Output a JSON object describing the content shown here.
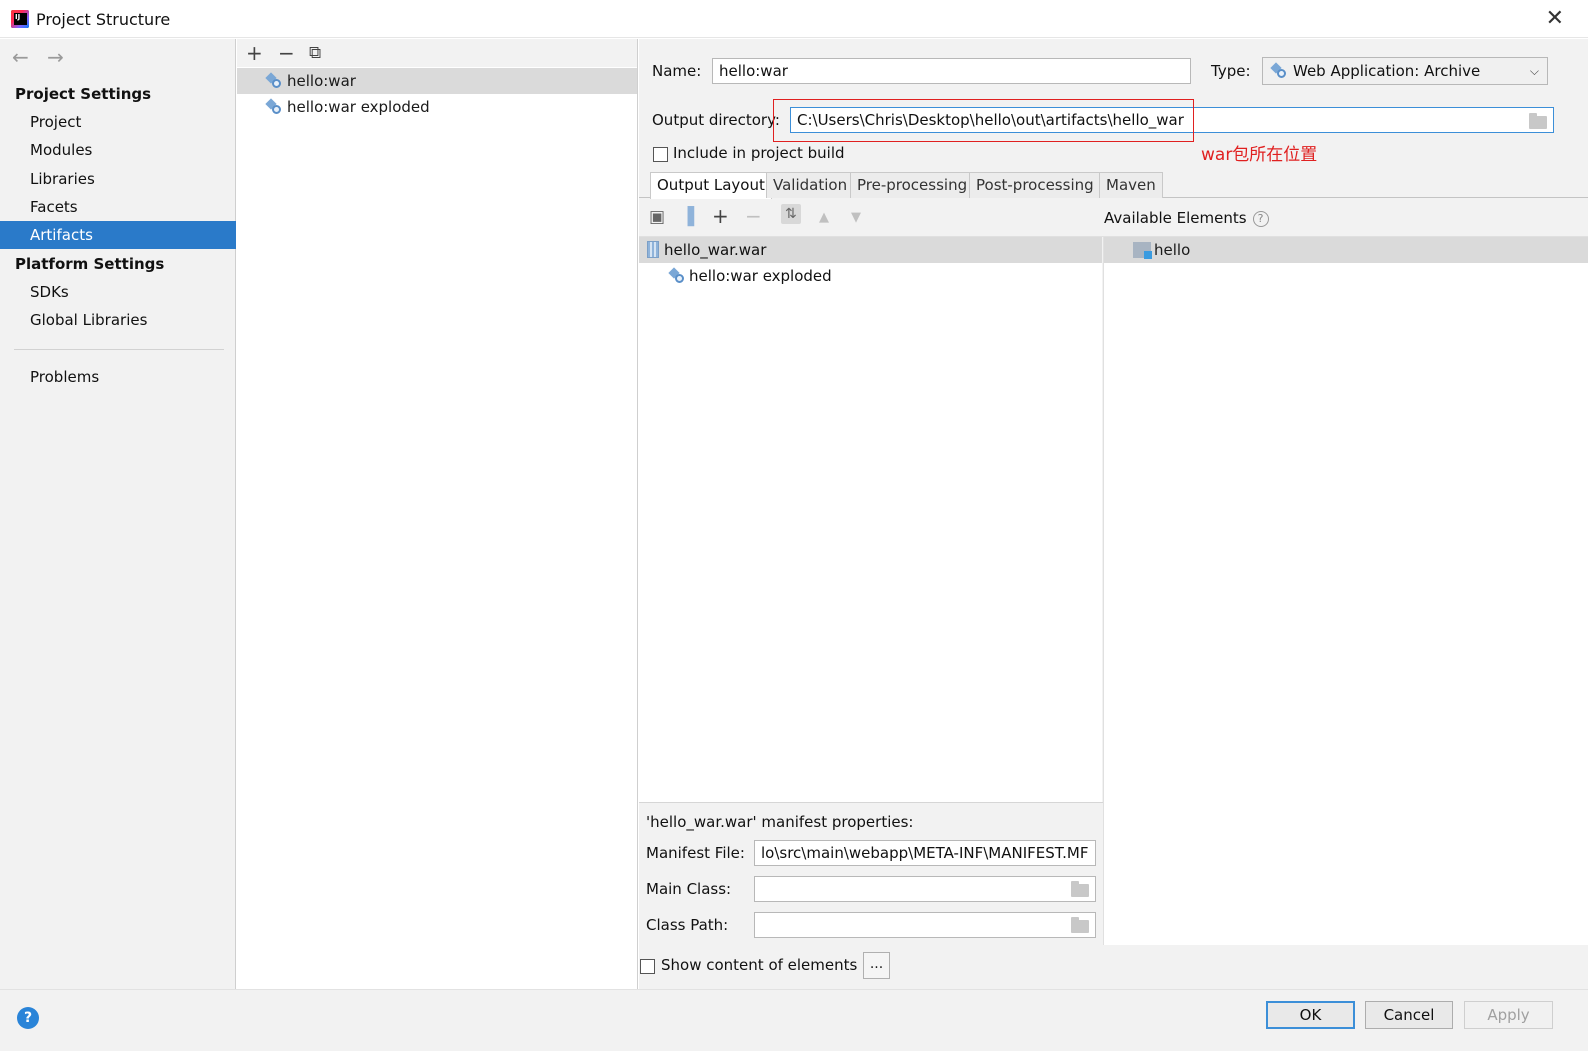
{
  "window": {
    "title": "Project Structure",
    "close_glyph": "✕",
    "icon": "intellij-icon"
  },
  "nav": {
    "back_glyph": "←",
    "forward_glyph": "→",
    "project_settings_heading": "Project Settings",
    "project_items": [
      "Project",
      "Modules",
      "Libraries",
      "Facets",
      "Artifacts"
    ],
    "selected": "Artifacts",
    "platform_settings_heading": "Platform Settings",
    "platform_items": [
      "SDKs",
      "Global Libraries"
    ],
    "problems": "Problems"
  },
  "artifacts_list": {
    "add_glyph": "+",
    "remove_glyph": "−",
    "copy_glyph": "⧉",
    "items": [
      "hello:war",
      "hello:war exploded"
    ],
    "selected": "hello:war"
  },
  "detail": {
    "name_label": "Name:",
    "name_value": "hello:war",
    "type_label": "Type:",
    "type_value": "Web Application: Archive",
    "output_dir_label": "Output directory:",
    "output_dir_value": "C:\\Users\\Chris\\Desktop\\hello\\out\\artifacts\\hello_war",
    "include_build_label": "Include in project build",
    "include_build_checked": false,
    "annotation_text": "war包所在位置",
    "annotation_color": "#e02020"
  },
  "tabs": [
    "Output Layout",
    "Validation",
    "Pre-processing",
    "Post-processing",
    "Maven"
  ],
  "active_tab": "Output Layout",
  "layout": {
    "tree": [
      "hello_war.war",
      "hello:war exploded"
    ],
    "available_heading": "Available Elements",
    "available_items": [
      "hello"
    ]
  },
  "manifest": {
    "heading": "'hello_war.war' manifest properties:",
    "manifest_file_label": "Manifest File:",
    "manifest_file_value": "lo\\src\\main\\webapp\\META-INF\\MANIFEST.MF",
    "main_class_label": "Main Class:",
    "main_class_value": "",
    "class_path_label": "Class Path:",
    "class_path_value": ""
  },
  "show_content_label": "Show content of elements",
  "show_content_checked": false,
  "dots_label": "...",
  "footer": {
    "help_glyph": "?",
    "ok": "OK",
    "cancel": "Cancel",
    "apply": "Apply"
  },
  "colors": {
    "selection": "#2a7ac9",
    "focus_border": "#3c8fd8",
    "panel": "#f2f2f2"
  }
}
